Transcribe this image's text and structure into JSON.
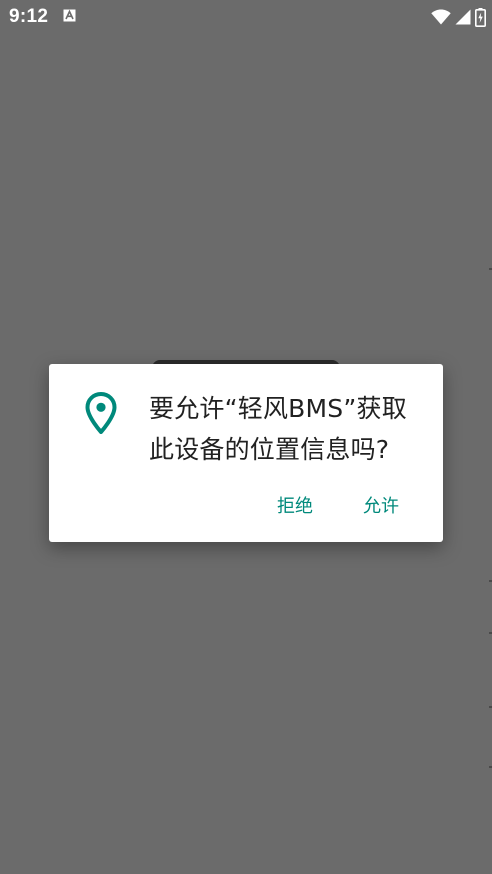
{
  "status_bar": {
    "time": "9:12",
    "app_icon": "text-a-icon",
    "indicators": [
      "wifi-icon",
      "signal-icon",
      "battery-charging-icon"
    ]
  },
  "dialog": {
    "icon": "location-pin-icon",
    "message": "要允许“轻风BMS”获取此设备的位置信息吗?",
    "deny_label": "拒绝",
    "allow_label": "允许"
  },
  "colors": {
    "scrim": "#6b6b6b",
    "accent": "#00897b",
    "dialog_background": "#ffffff",
    "text": "#212121"
  }
}
